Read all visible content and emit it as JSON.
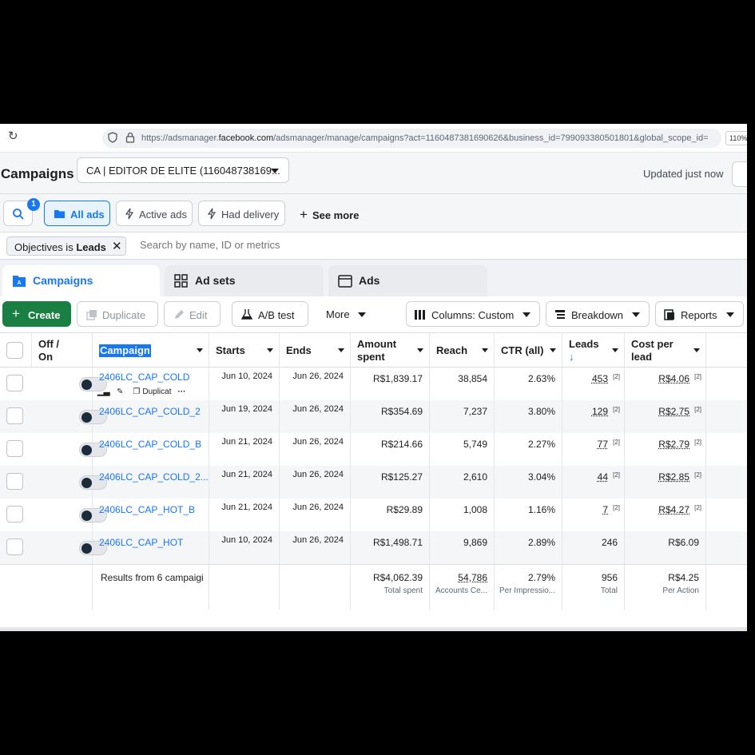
{
  "browser": {
    "url_prefix": "https://adsmanager.",
    "url_host": "facebook.com",
    "url_rest": "/adsmanager/manage/campaigns?act=1160487381690626&business_id=799093380501801&global_scope_id=",
    "zoom": "110%"
  },
  "header": {
    "title": "Campaigns",
    "account": "CA | EDITOR DE ELITE (116048738169...",
    "updated": "Updated just now"
  },
  "filters": {
    "search_badge": "1",
    "all_ads": "All ads",
    "active_ads": "Active ads",
    "had_delivery": "Had delivery",
    "see_more": "See more"
  },
  "chip": {
    "prefix": "Objectives is ",
    "value": "Leads",
    "search_placeholder": "Search by name, ID or metrics"
  },
  "tabs": {
    "campaigns": "Campaigns",
    "adsets": "Ad sets",
    "ads": "Ads"
  },
  "toolbar": {
    "create": "Create",
    "duplicate": "Duplicate",
    "edit": "Edit",
    "ab_test": "A/B test",
    "more": "More",
    "columns": "Columns: Custom",
    "breakdown": "Breakdown",
    "reports": "Reports"
  },
  "columns": {
    "offon_1": "Off /",
    "offon_2": "On",
    "campaign": "Campaign",
    "starts": "Starts",
    "ends": "Ends",
    "amount_1": "Amount",
    "amount_2": "spent",
    "reach": "Reach",
    "ctr": "CTR (all)",
    "leads": "Leads",
    "leads_sort": "↓",
    "cpl_1": "Cost per",
    "cpl_2": "lead"
  },
  "row_actions": {
    "duplicate": "Duplicat"
  },
  "rows": [
    {
      "name": "2406LC_CAP_COLD",
      "starts": "Jun 10, 2024",
      "ends": "Jun 26, 2024",
      "amount": "R$1,839.17",
      "reach": "38,854",
      "ctr": "2.63%",
      "leads": "453",
      "cpl": "R$4.06",
      "sup": "[2]"
    },
    {
      "name": "2406LC_CAP_COLD_2",
      "starts": "Jun 19, 2024",
      "ends": "Jun 26, 2024",
      "amount": "R$354.69",
      "reach": "7,237",
      "ctr": "3.80%",
      "leads": "129",
      "cpl": "R$2.75",
      "sup": "[2]"
    },
    {
      "name": "2406LC_CAP_COLD_B",
      "starts": "Jun 21, 2024",
      "ends": "Jun 26, 2024",
      "amount": "R$214.66",
      "reach": "5,749",
      "ctr": "2.27%",
      "leads": "77",
      "cpl": "R$2.79",
      "sup": "[2]"
    },
    {
      "name": "2406LC_CAP_COLD_2...",
      "starts": "Jun 21, 2024",
      "ends": "Jun 26, 2024",
      "amount": "R$125.27",
      "reach": "2,610",
      "ctr": "3.04%",
      "leads": "44",
      "cpl": "R$2.85",
      "sup": "[2]"
    },
    {
      "name": "2406LC_CAP_HOT_B",
      "starts": "Jun 21, 2024",
      "ends": "Jun 26, 2024",
      "amount": "R$29.89",
      "reach": "1,008",
      "ctr": "1.16%",
      "leads": "7",
      "cpl": "R$4.27",
      "sup": "[2]"
    },
    {
      "name": "2406LC_CAP_HOT",
      "starts": "Jun 10, 2024",
      "ends": "Jun 26, 2024",
      "amount": "R$1,498.71",
      "reach": "9,869",
      "ctr": "2.89%",
      "leads": "246",
      "cpl": "R$6.09",
      "sup": ""
    }
  ],
  "summary": {
    "label": "Results from 6 campaigi",
    "amount": "R$4,062.39",
    "amount_sub": "Total spent",
    "reach": "54,786",
    "reach_sub": "Accounts Ce...",
    "ctr": "2.79%",
    "ctr_sub": "Per Impressio...",
    "leads": "956",
    "leads_sub": "Total",
    "cpl": "R$4.25",
    "cpl_sub": "Per Action"
  }
}
